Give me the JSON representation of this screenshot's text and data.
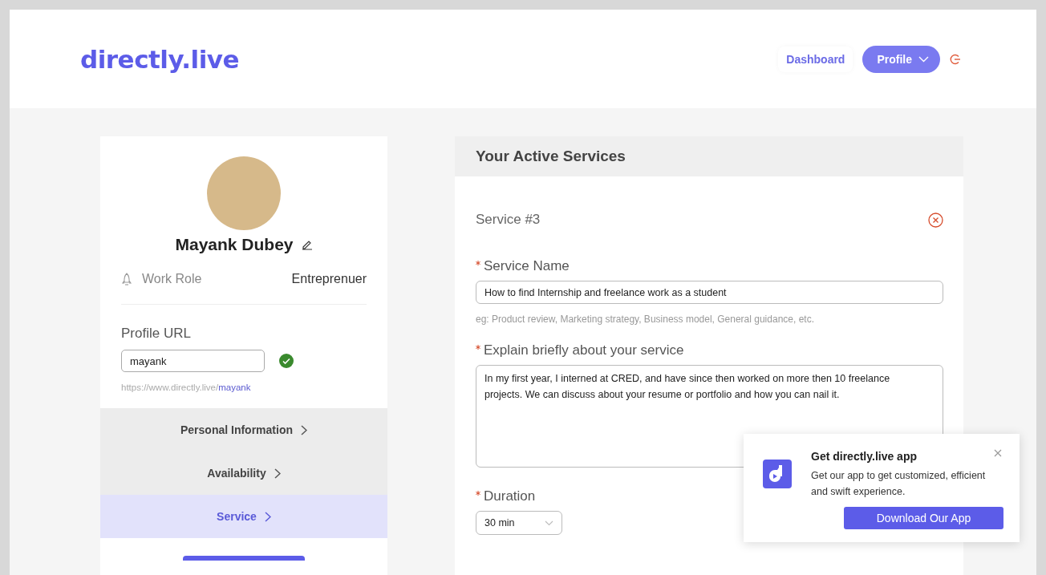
{
  "header": {
    "logo": "directly.live",
    "nav": [
      {
        "kind": "link",
        "label": "Dashboard"
      },
      {
        "kind": "menu",
        "label": "Profile"
      }
    ]
  },
  "profile": {
    "name": "Mayank Dubey",
    "work_role": {
      "label": "Work Role",
      "value": "Entreprenuer"
    },
    "url": {
      "label": "Profile URL",
      "value": "mayank",
      "verified": true,
      "prefix": "https://www.directly.live/",
      "slug": "mayank"
    },
    "sections": [
      {
        "label": "Personal Information",
        "selected": false
      },
      {
        "label": "Availability",
        "selected": false
      },
      {
        "label": "Service",
        "selected": true
      }
    ]
  },
  "services": {
    "title": "Your Active Services",
    "service_title": "Service #3",
    "fields": [
      {
        "kind": "input",
        "label": "Service Name",
        "required": true,
        "value": "How to find Internship and freelance work as a student",
        "hint": "eg: Product review, Marketing strategy, Business model, General guidance, etc."
      },
      {
        "kind": "textarea",
        "label": "Explain briefly about your service",
        "required": true,
        "value": "In my first year, I interned at CRED, and have since then worked on more then 10 freelance projects. We can discuss about your resume or portfolio and how you can nail it."
      },
      {
        "kind": "select",
        "label": "Duration",
        "required": true,
        "value": "30 min"
      }
    ]
  },
  "popup": {
    "title": "Get directly.live app",
    "text": "Get our app to get customized, efficient and swift experience.",
    "button": "Download Our App"
  }
}
